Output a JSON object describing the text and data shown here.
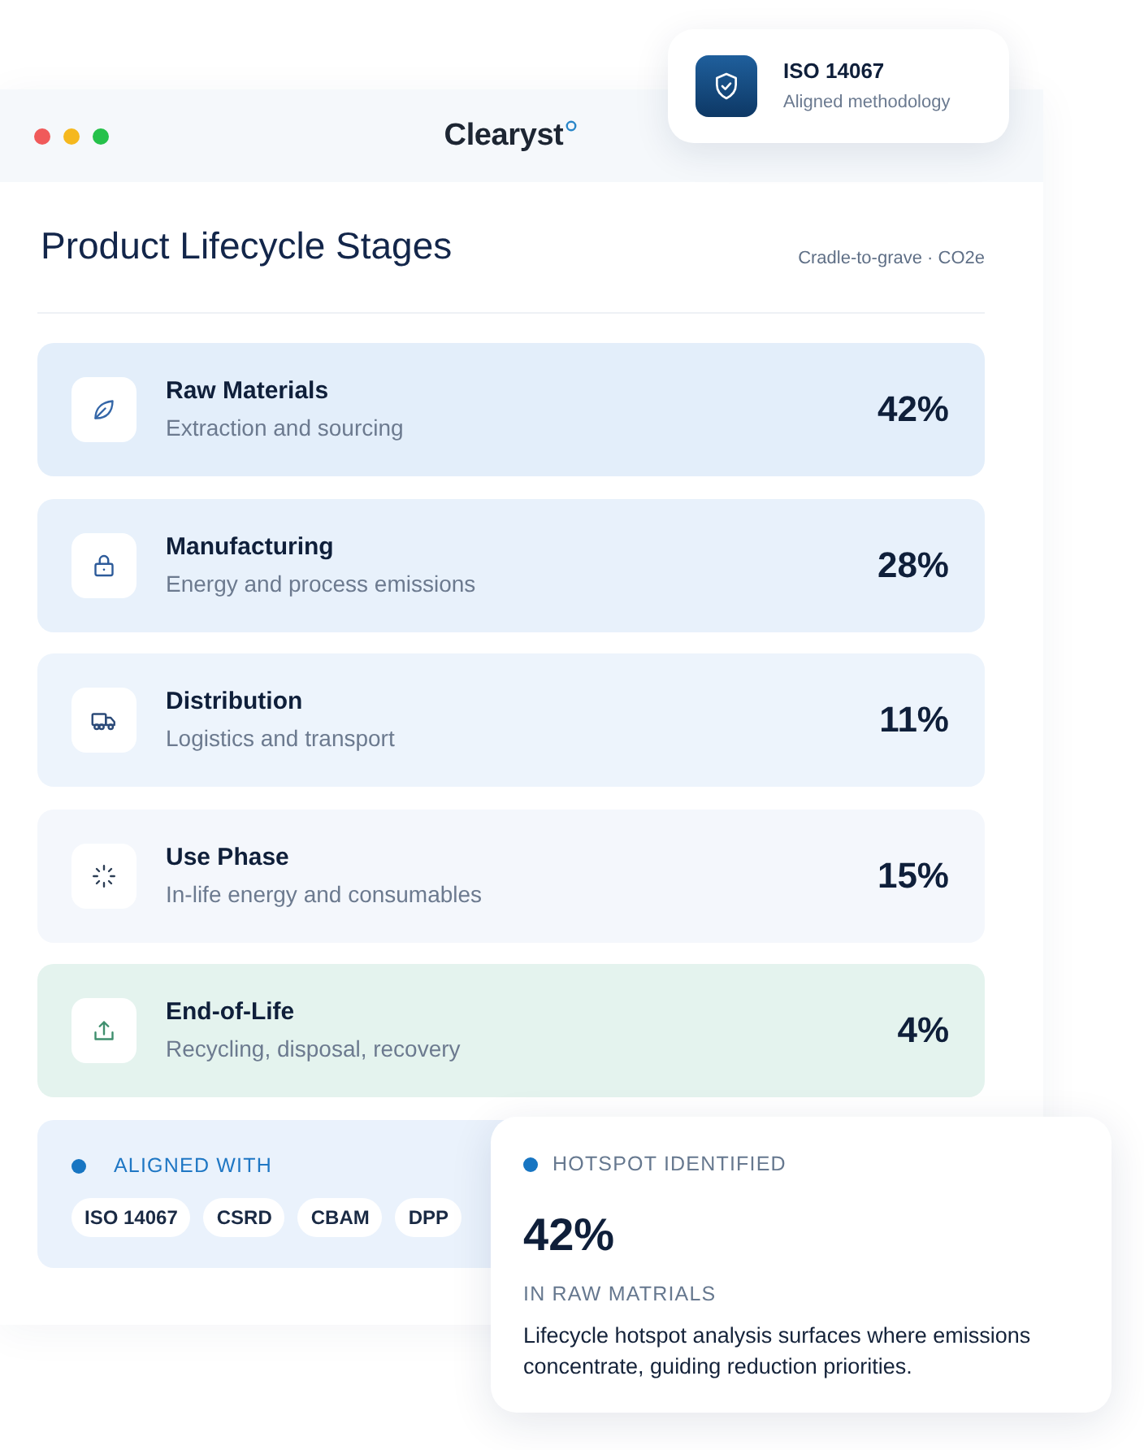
{
  "window": {
    "logo": "Clearyst"
  },
  "badge": {
    "title": "ISO 14067",
    "subtitle": "Aligned methodology"
  },
  "header": {
    "title": "Product Lifecycle Stages",
    "scope": "Cradle-to-grave · CO2e"
  },
  "stages": [
    {
      "name": "Raw Materials",
      "description": "Extraction and sourcing",
      "share": "42%",
      "color": "#e3eefa"
    },
    {
      "name": "Manufacturing",
      "description": "Energy and process emissions",
      "share": "28%",
      "color": "#e8f1fb"
    },
    {
      "name": "Distribution",
      "description": "Logistics and transport",
      "share": "11%",
      "color": "#edf4fc"
    },
    {
      "name": "Use Phase",
      "description": "In-life energy and consumables",
      "share": "15%",
      "color": "#f4f7fc"
    },
    {
      "name": "End-of-Life",
      "description": "Recycling, disposal, recovery",
      "share": "4%",
      "color": "#e4f3ee"
    }
  ],
  "aligned": {
    "heading": "ALIGNED WITH",
    "standards": [
      "ISO 14067",
      "CSRD",
      "CBAM",
      "DPP"
    ]
  },
  "hotspot": {
    "heading": "HOTSPOT IDENTIFIED",
    "value": "42%",
    "caption": "IN RAW MATRIALS",
    "text": "Lifecycle hotspot analysis surfaces where emissions concentrate, guiding reduction priorities."
  }
}
